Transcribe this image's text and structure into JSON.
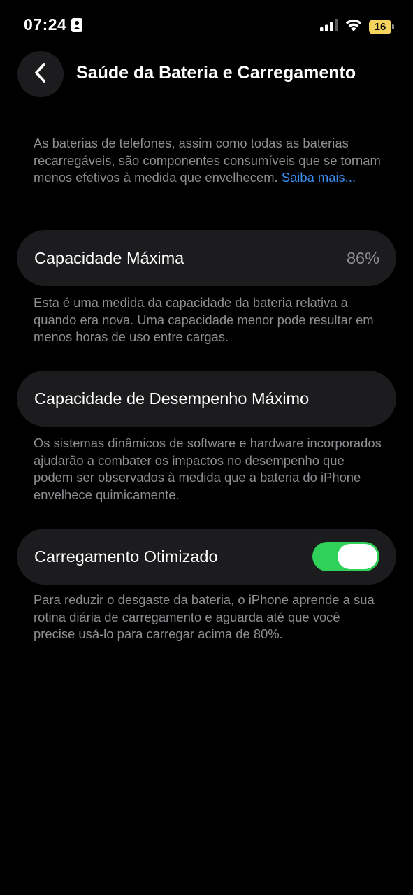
{
  "status_bar": {
    "time": "07:24",
    "battery_level": "16",
    "battery_color": "#f4d35e",
    "icons": [
      "focus-mode-icon",
      "cellular-signal-icon",
      "wifi-icon",
      "battery-icon"
    ]
  },
  "header": {
    "back_icon": "chevron-left-icon",
    "title": "Saúde da Bateria e Carregamento"
  },
  "intro": {
    "text": "As baterias de telefones, assim como todas as baterias recarregáveis, são componentes consumíveis que se tornam menos efetivos à medida que envelhecem.",
    "link": "Saiba mais..."
  },
  "max_capacity": {
    "label": "Capacidade Máxima",
    "value": "86%",
    "description": "Esta é uma medida da capacidade da bateria relativa a quando era nova. Uma capacidade menor pode resultar em menos horas de uso entre cargas."
  },
  "peak_performance": {
    "label": "Capacidade de Desempenho Máximo",
    "description": "Os sistemas dinâmicos de software e hardware incorporados ajudarão a combater os impactos no desempenho que podem ser observados à medida que a bateria do iPhone envelhece quimicamente."
  },
  "optimized_charging": {
    "label": "Carregamento Otimizado",
    "enabled": true,
    "toggle_color": "#30d158",
    "description": "Para reduzir o desgaste da bateria, o iPhone aprende a sua rotina diária de carregamento e aguarda até que você precise usá-lo para carregar acima de 80%."
  }
}
